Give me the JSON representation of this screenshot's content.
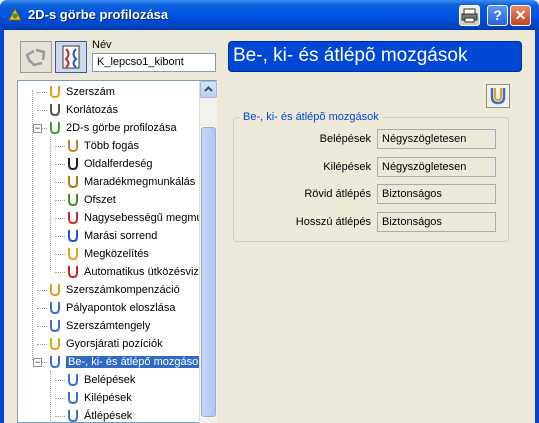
{
  "window": {
    "title": "2D-s görbe profilozása",
    "buttons": [
      "print",
      "help",
      "close"
    ]
  },
  "name_field": {
    "label": "Név",
    "value": "K_lepcso1_kibont"
  },
  "page_title": "Be-, ki- és átlépõ mozgások",
  "tree": [
    {
      "label": "Szerszám",
      "icon": "tool-icon"
    },
    {
      "label": "Korlátozás",
      "icon": "limit-icon"
    },
    {
      "label": "2D-s görbe profilozása",
      "icon": "profile-icon",
      "expander": "−"
    },
    {
      "label": "Több fogás",
      "icon": "multiple-cuts-icon"
    },
    {
      "label": "Oldalferdeség",
      "icon": "side-angle-icon"
    },
    {
      "label": "Maradékmegmunkálás",
      "icon": "rest-machining-icon"
    },
    {
      "label": "Ofszet",
      "icon": "offset-icon"
    },
    {
      "label": "Nagysebességű megmur",
      "icon": "high-speed-icon"
    },
    {
      "label": "Marási sorrend",
      "icon": "milling-order-icon"
    },
    {
      "label": "Megközelítés",
      "icon": "approach-icon"
    },
    {
      "label": "Automatikus ütközésvizs",
      "icon": "collision-check-icon"
    },
    {
      "label": "Szerszámkompenzáció",
      "icon": "tool-compensation-icon"
    },
    {
      "label": "Pályapontok eloszlása",
      "icon": "point-distribution-icon"
    },
    {
      "label": "Szerszámtengely",
      "icon": "tool-axis-icon"
    },
    {
      "label": "Gyorsjárati pozíciók",
      "icon": "rapid-positions-icon"
    },
    {
      "label": "Be-, ki- és átlépő mozgások",
      "icon": "leads-links-icon",
      "expander": "−",
      "selected": true
    },
    {
      "label": "Belépések",
      "icon": "lead-in-icon"
    },
    {
      "label": "Kilépések",
      "icon": "lead-out-icon"
    },
    {
      "label": "Átlépések",
      "icon": "links-icon"
    }
  ],
  "group": {
    "title": "Be-, ki- és átlépõ mozgások",
    "rows": [
      {
        "label": "Belépések",
        "value": "Négyszögletesen"
      },
      {
        "label": "Kilépések",
        "value": "Négyszögletesen"
      },
      {
        "label": "Rövid átlépés",
        "value": "Biztonságos"
      },
      {
        "label": "Hosszú átlépés",
        "value": "Biztonságos"
      }
    ]
  },
  "colors": {
    "titlebar": "#0054e3",
    "title_banner": "#0047d6",
    "selection": "#316ac5",
    "group_title": "#0046d5"
  }
}
